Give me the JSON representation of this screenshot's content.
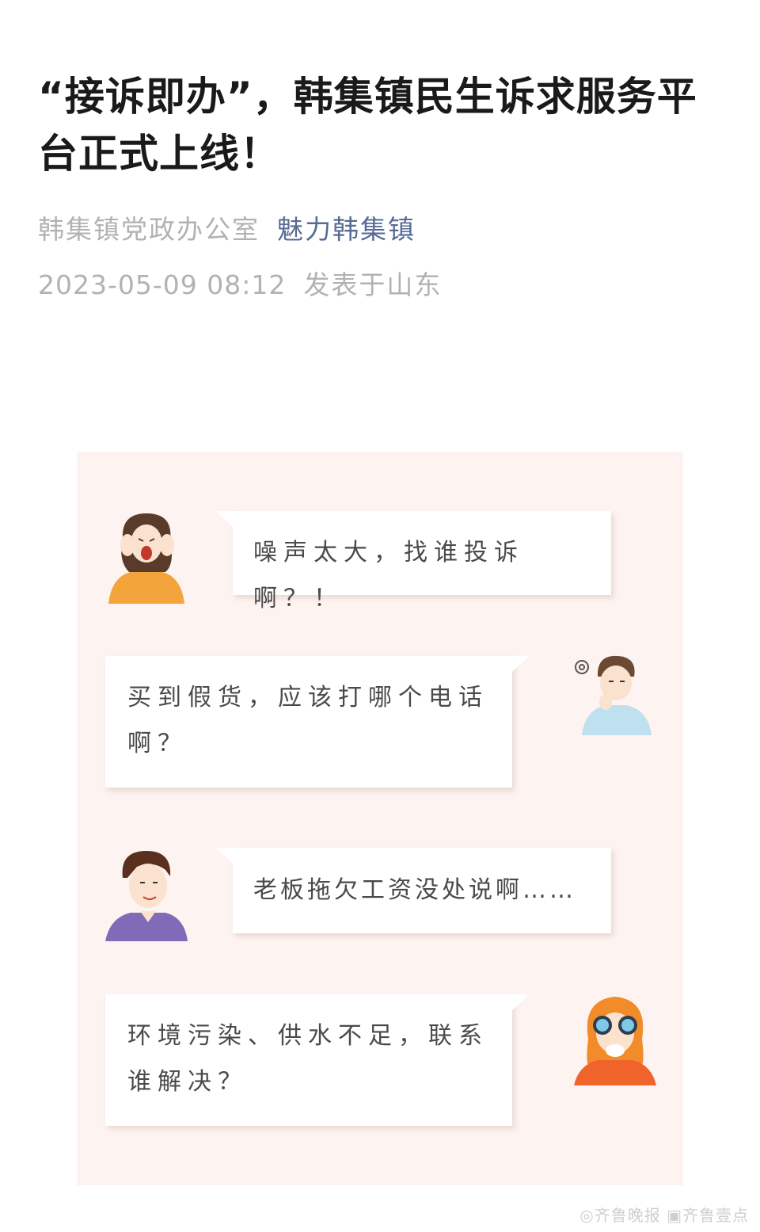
{
  "article": {
    "title": "“接诉即办”，韩集镇民生诉求服务平台正式上线！",
    "author": "韩集镇党政办公室",
    "account": "魅力韩集镇",
    "datetime": "2023-05-09 08:12",
    "location": "发表于山东"
  },
  "dialogue": [
    {
      "text": "噪声太大，找谁投诉啊？！"
    },
    {
      "text": "买到假货，应该打哪个电话啊？"
    },
    {
      "text": "老板拖欠工资没处说啊……"
    },
    {
      "text": "环境污染、供水不足，联系谁解决？"
    }
  ],
  "watermark": "◎齐鲁晚报 ▣齐鲁壹点",
  "colors": {
    "account_link": "#576b95",
    "card_bg": "#fdf3f0",
    "meta_text": "#b2b2b2"
  }
}
